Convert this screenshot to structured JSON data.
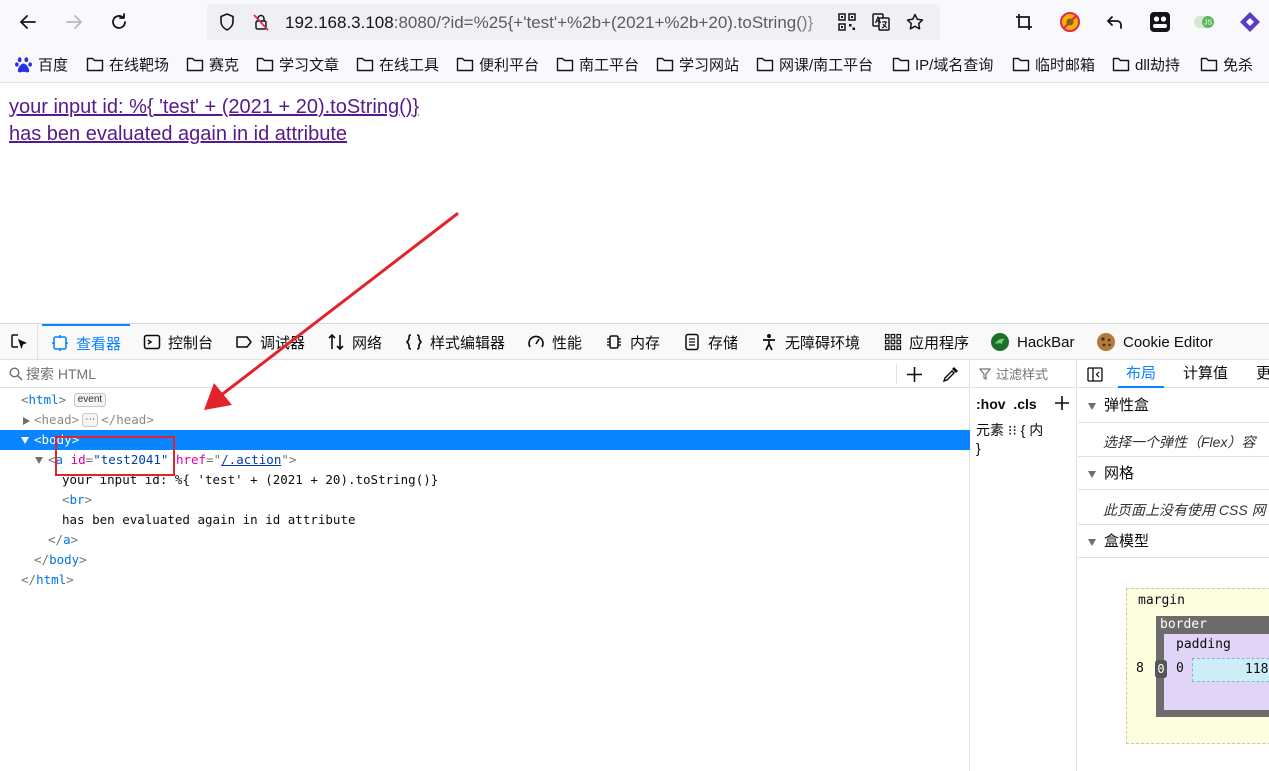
{
  "toolbar": {
    "url_host": "192.168.3.108",
    "url_rest": ":8080/?id=%25{+'test'+%2b+(2021+%2b+20).toString()}"
  },
  "bookmarks": [
    {
      "label": "百度",
      "icon": "paw-icon"
    },
    {
      "label": "在线靶场",
      "icon": "folder-icon"
    },
    {
      "label": "赛克",
      "icon": "folder-icon"
    },
    {
      "label": "学习文章",
      "icon": "folder-icon"
    },
    {
      "label": "在线工具",
      "icon": "folder-icon"
    },
    {
      "label": "便利平台",
      "icon": "folder-icon"
    },
    {
      "label": "南工平台",
      "icon": "folder-icon"
    },
    {
      "label": "学习网站",
      "icon": "folder-icon"
    },
    {
      "label": "网课/南工平台",
      "icon": "folder-icon"
    },
    {
      "label": "IP/域名查询",
      "icon": "folder-icon"
    },
    {
      "label": "临时邮箱",
      "icon": "folder-icon"
    },
    {
      "label": "dll劫持",
      "icon": "folder-icon"
    },
    {
      "label": "免杀",
      "icon": "folder-icon"
    }
  ],
  "page": {
    "link_line1": "your input id: %{ 'test' + (2021 + 20).toString()}",
    "link_line2": "has ben evaluated again in id attribute"
  },
  "devtools": {
    "tabs": [
      "查看器",
      "控制台",
      "调试器",
      "网络",
      "样式编辑器",
      "性能",
      "内存",
      "存储",
      "无障碍环境",
      "应用程序",
      "HackBar",
      "Cookie Editor"
    ],
    "search_placeholder": "搜索 HTML",
    "tree": {
      "html": "html",
      "event_badge": "event",
      "head": "head",
      "ellipsis": "⋯",
      "body": "body",
      "a": "a",
      "attr_id_name": "id",
      "attr_id_value": "\"test2041\"",
      "attr_href_name": "href",
      "attr_href_value": "/.action",
      "text1": "your input id: %{ 'test' + (2021 + 20).toString()}",
      "br": "br",
      "text2": "has ben evaluated again in id attribute"
    },
    "rules": {
      "filter_placeholder": "过滤样式",
      "hov": ":hov",
      "cls": ".cls",
      "element_rule": "元素 ⁝⁝ {  内",
      "close_brace": "}"
    },
    "layout": {
      "tabs": [
        "布局",
        "计算值",
        "更"
      ],
      "flex_title": "弹性盒",
      "flex_note": "选择一个弹性（Flex）容",
      "grid_title": "网格",
      "grid_note": "此页面上没有使用 CSS 网",
      "box_title": "盒模型",
      "box_margin": "margin",
      "box_border": "border",
      "box_padding": "padding",
      "margin_left": "8",
      "border_left": "0",
      "padding_left": "0",
      "content_width": "118"
    }
  },
  "colors": {
    "selection": "#0a84ff",
    "annotation": "#e3232c",
    "visited_link": "#551a8b"
  }
}
